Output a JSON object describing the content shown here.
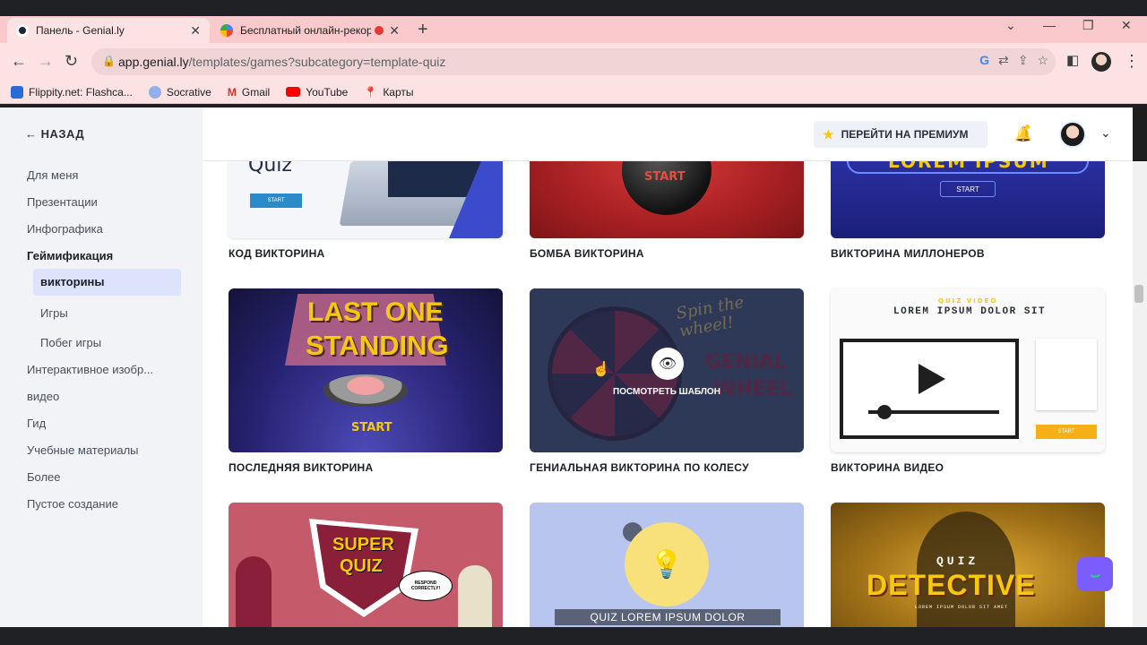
{
  "browser": {
    "tabs": [
      {
        "title": "Панель - Genial.ly",
        "active": true
      },
      {
        "title": "Бесплатный онлайн-рекор",
        "active": false
      }
    ],
    "new_tab": "+",
    "window_controls": {
      "dropdown": "⌄",
      "minimize": "—",
      "restore": "❐",
      "close": "✕"
    },
    "url": {
      "host": "app.genial.ly",
      "path": "/templates/games?subcategory=template-quiz"
    },
    "bookmarks": [
      {
        "label": "Flippity.net: Flashca...",
        "color": "#2a6ad9"
      },
      {
        "label": "Socrative",
        "color": "#8fb0e9"
      },
      {
        "label": "Gmail",
        "color": "#d93025"
      },
      {
        "label": "YouTube",
        "color": "#ff0000"
      },
      {
        "label": "Карты",
        "color": "#34a853"
      }
    ]
  },
  "sidebar": {
    "back_label": "НАЗАД",
    "items": [
      {
        "label": "Для меня"
      },
      {
        "label": "Презентации"
      },
      {
        "label": "Инфографика"
      },
      {
        "label": "Геймификация"
      },
      {
        "label": "викторины"
      },
      {
        "label": "Игры"
      },
      {
        "label": "Побег игры"
      },
      {
        "label": "Интерактивное изобр..."
      },
      {
        "label": "видео"
      },
      {
        "label": "Гид"
      },
      {
        "label": "Учебные материалы"
      },
      {
        "label": "Более"
      },
      {
        "label": "Пустое создание"
      }
    ]
  },
  "header": {
    "premium_label": "ПЕРЕЙТИ НА ПРЕМИУМ"
  },
  "templates": {
    "row1": [
      {
        "title": "КОД ВИКТОРИНА",
        "art_text": "Quiz",
        "art_button": "START"
      },
      {
        "title": "БОМБА ВИКТОРИНА",
        "art_button": "START"
      },
      {
        "title": "ВИКТОРИНА МИЛЛОНЕРОВ",
        "art_text": "LOREM IPSUM",
        "art_button": "START"
      }
    ],
    "row2": [
      {
        "title": "ПОСЛЕДНЯЯ ВИКТОРИНА",
        "art_line1": "LAST ONE",
        "art_line2": "STANDING",
        "art_button": "START"
      },
      {
        "title": "ГЕНИАЛЬНАЯ ВИКТОРИНА ПО КОЛЕСУ",
        "art_script": "Spin the wheel!",
        "art_line1": "GENIAL",
        "art_line2": "WHEEL",
        "overlay_label": "ПОСМОТРЕТЬ ШАБЛОН"
      },
      {
        "title": "ВИКТОРИНА ВИДЕО",
        "art_kicker": "QUIZ VIDEO",
        "art_heading": "LOREM IPSUM DOLOR SIT",
        "art_button": "START"
      }
    ],
    "row3": [
      {
        "art_line1": "SUPER",
        "art_line2": "QUIZ",
        "art_bubble": "RESPOND CORRECTLY!"
      },
      {
        "art_caption": "QUIZ LOREM IPSUM DOLOR"
      },
      {
        "art_kicker": "QUIZ",
        "art_heading": "DETECTIVE",
        "art_sub": "LOREM IPSUM DOLOR SIT AMET"
      }
    ]
  },
  "colors": {
    "tab_strip": "#f9c9cc",
    "sidebar_bg": "#f2f3f7",
    "active_nav": "#dde3fb",
    "accent_yellow": "#f6c90e"
  }
}
